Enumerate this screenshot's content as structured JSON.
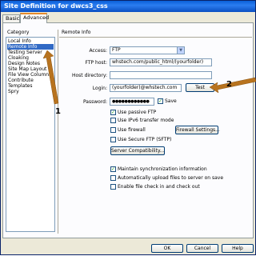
{
  "window": {
    "title": "Site Definition for dwcs3_css"
  },
  "tabs": [
    {
      "label": "Basic"
    },
    {
      "label": "Advanced"
    }
  ],
  "category": {
    "label": "Category",
    "items": [
      "Local Info",
      "Remote Info",
      "Testing Server",
      "Cloaking",
      "Design Notes",
      "Site Map Layout",
      "File View Columns",
      "Contribute",
      "Templates",
      "Spry"
    ],
    "selected": "Remote Info"
  },
  "remote": {
    "section_title": "Remote Info",
    "access_label": "Access:",
    "access_value": "FTP",
    "ftp_host_label": "FTP host:",
    "ftp_host_value": "whstech.com/public_html/(yourfolder)",
    "host_dir_label": "Host directory:",
    "host_dir_value": "",
    "login_label": "Login:",
    "login_value": "(yourfolder)@whstech.com",
    "test_button": "Test",
    "password_label": "Password:",
    "password_value": "●●●●●●●●●●●●",
    "save_label": "Save",
    "save_checked": true,
    "passive_ftp_label": "Use passive FTP",
    "passive_ftp_checked": true,
    "ipv6_label": "Use IPv6 transfer mode",
    "firewall_label": "Use firewall",
    "firewall_button": "Firewall Settings...",
    "sftp_label": "Use Secure FTP (SFTP)",
    "server_compat_button": "Server Compatibility...",
    "maintain_sync_label": "Maintain synchronization information",
    "maintain_sync_checked": true,
    "auto_upload_label": "Automatically upload files to server on save",
    "check_inout_label": "Enable file check in and check out"
  },
  "footer": {
    "ok": "OK",
    "cancel": "Cancel",
    "help": "Help"
  },
  "annotations": {
    "arrow1": "1",
    "arrow2": "2"
  },
  "colors": {
    "arrow": "#b8731e",
    "selection": "#316ac5",
    "titlebar": "#0a5fd8"
  }
}
